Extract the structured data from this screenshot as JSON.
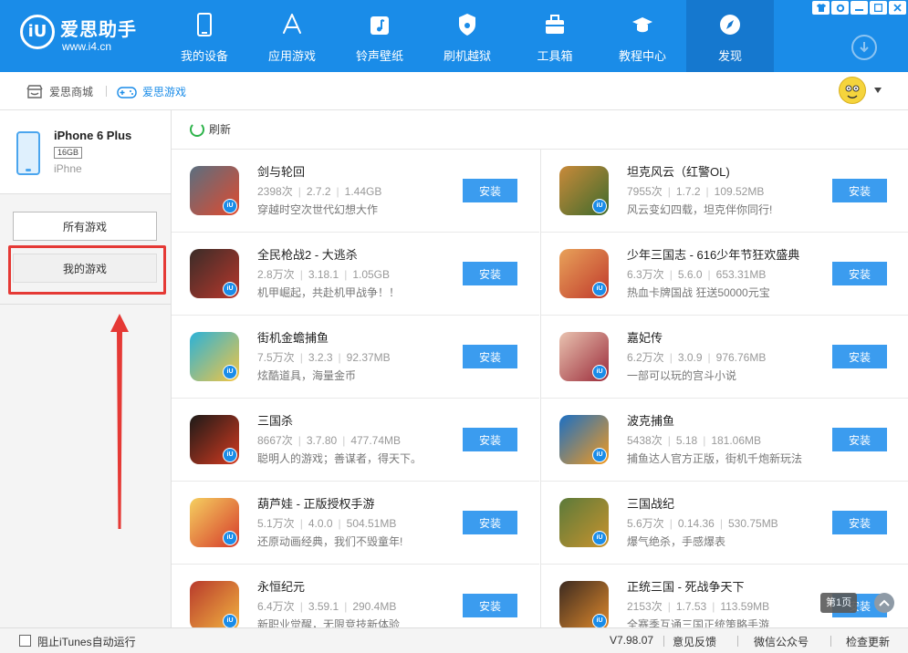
{
  "brand": {
    "name": "爱思助手",
    "url": "www.i4.cn",
    "mark": "iU"
  },
  "nav": [
    {
      "label": "我的设备",
      "icon": "phone-icon"
    },
    {
      "label": "应用游戏",
      "icon": "appstore-icon"
    },
    {
      "label": "铃声壁纸",
      "icon": "music-icon"
    },
    {
      "label": "刷机越狱",
      "icon": "flash-icon"
    },
    {
      "label": "工具箱",
      "icon": "toolbox-icon"
    },
    {
      "label": "教程中心",
      "icon": "graduation-cap-icon"
    },
    {
      "label": "发现",
      "icon": "compass-icon",
      "active": true
    }
  ],
  "subbar": {
    "mall": "爱思商城",
    "games": "爱思游戏"
  },
  "device": {
    "name": "iPhone 6 Plus",
    "capacity": "16GB",
    "model": "iPhne"
  },
  "sidebar": {
    "all_games": "所有游戏",
    "my_games": "我的游戏"
  },
  "toolbar": {
    "refresh": "刷新"
  },
  "apps": [
    {
      "name": "剑与轮回",
      "downloads": "2398次",
      "version": "2.7.2",
      "size": "1.44GB",
      "desc": "穿越时空次世代幻想大作",
      "icon_color": "#5a6f80",
      "icon_accent": "#e14a2e"
    },
    {
      "name": "坦克风云（红警OL)",
      "downloads": "7955次",
      "version": "1.7.2",
      "size": "109.52MB",
      "desc": "风云变幻四载，坦克伴你同行!",
      "icon_color": "#c98a3a",
      "icon_accent": "#3e6b2c"
    },
    {
      "name": "全民枪战2 - 大逃杀",
      "downloads": "2.8万次",
      "version": "3.18.1",
      "size": "1.05GB",
      "desc": "机甲崛起，共赴机甲战争！！",
      "icon_color": "#3a2c28",
      "icon_accent": "#b8372c"
    },
    {
      "name": "少年三国志 - 616少年节狂欢盛典",
      "downloads": "6.3万次",
      "version": "5.6.0",
      "size": "653.31MB",
      "desc": "热血卡牌国战 狂送50000元宝",
      "icon_color": "#e8a25a",
      "icon_accent": "#c0392b"
    },
    {
      "name": "街机金蟾捕鱼",
      "downloads": "7.5万次",
      "version": "3.2.3",
      "size": "92.37MB",
      "desc": "炫酷道具，海量金币",
      "icon_color": "#2bb2d8",
      "icon_accent": "#f4c542"
    },
    {
      "name": "嘉妃传",
      "downloads": "6.2万次",
      "version": "3.0.9",
      "size": "976.76MB",
      "desc": "一部可以玩的宫斗小说",
      "icon_color": "#e9c3b0",
      "icon_accent": "#9b2b3a"
    },
    {
      "name": "三国杀",
      "downloads": "8667次",
      "version": "3.7.80",
      "size": "477.74MB",
      "desc": "聪明人的游戏；善谋者，得天下。",
      "icon_color": "#1c1a18",
      "icon_accent": "#d43a20"
    },
    {
      "name": "波克捕鱼",
      "downloads": "5438次",
      "version": "5.18",
      "size": "181.06MB",
      "desc": "捕鱼达人官方正版，街机千炮新玩法",
      "icon_color": "#1b6fc4",
      "icon_accent": "#f39a1e"
    },
    {
      "name": "葫芦娃 - 正版授权手游",
      "downloads": "5.1万次",
      "version": "4.0.0",
      "size": "504.51MB",
      "desc": "还原动画经典，我们不毁童年!",
      "icon_color": "#f5d060",
      "icon_accent": "#d63a2a"
    },
    {
      "name": "三国战纪",
      "downloads": "5.6万次",
      "version": "0.14.36",
      "size": "530.75MB",
      "desc": "爆气绝杀，手感爆表",
      "icon_color": "#5b7a3a",
      "icon_accent": "#c9932e"
    },
    {
      "name": "永恒纪元",
      "downloads": "6.4万次",
      "version": "3.59.1",
      "size": "290.4MB",
      "desc": "新职业觉醒，无限竞技新体验",
      "icon_color": "#b83a2c",
      "icon_accent": "#f2b440"
    },
    {
      "name": "正统三国 - 死战争天下",
      "downloads": "2153次",
      "version": "1.7.53",
      "size": "113.59MB",
      "desc": "全赛季互通三国正统策略手游",
      "icon_color": "#3c2a20",
      "icon_accent": "#e08a2c"
    }
  ],
  "install_label": "安装",
  "page_indicator": "第1页",
  "footer": {
    "itunes_block": "阻止iTunes自动运行",
    "version": "V7.98.07",
    "feedback": "意见反馈",
    "wechat": "微信公众号",
    "update": "检查更新"
  }
}
